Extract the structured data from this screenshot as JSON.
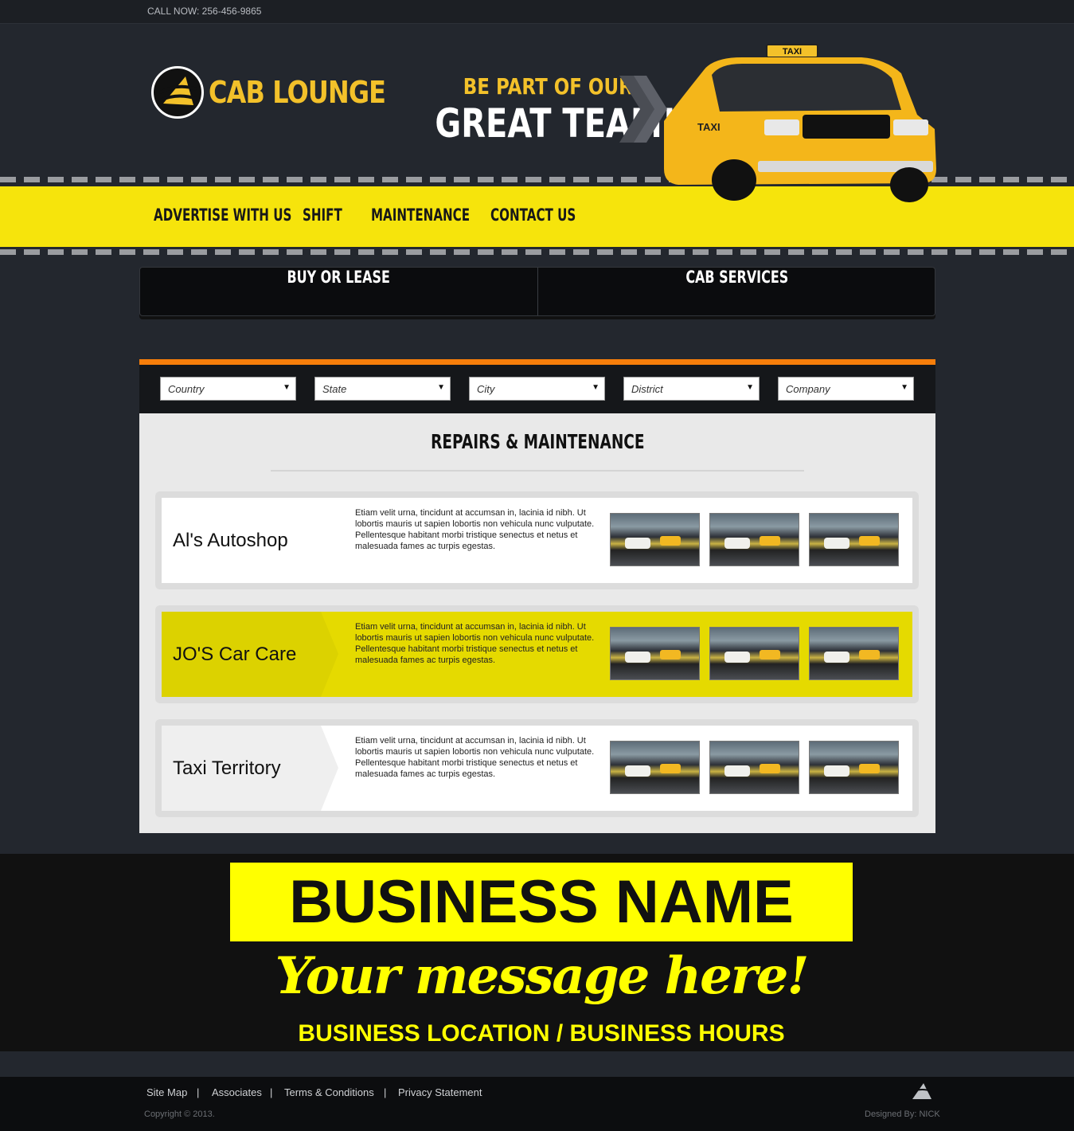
{
  "topbar": {
    "call": "CALL NOW: 256-456-9865"
  },
  "brand": {
    "name": "CAB LOUNGE"
  },
  "hero": {
    "tagline1": "BE PART OF OUR",
    "tagline2": "GREAT TEAM!"
  },
  "nav": [
    "ADVERTISE WITH US",
    "SHIFT",
    "MAINTENANCE",
    "CONTACT US"
  ],
  "tabs": [
    "BUY OR LEASE",
    "CAB SERVICES"
  ],
  "filters": [
    "Country",
    "State",
    "City",
    "District",
    "Company"
  ],
  "section": {
    "title": "REPAIRS & MAINTENANCE"
  },
  "listings": [
    {
      "name": "Al's Autoshop",
      "desc": "Etiam velit urna, tincidunt at accumsan in, lacinia id nibh. Ut lobortis mauris ut sapien lobortis non vehicula nunc vulputate. Pellentesque habitant morbi tristique senectus et netus et malesuada fames ac turpis egestas."
    },
    {
      "name": "JO'S Car Care",
      "desc": "Etiam velit urna, tincidunt at accumsan in, lacinia id nibh. Ut lobortis mauris ut sapien lobortis non vehicula nunc vulputate. Pellentesque habitant morbi tristique senectus et netus et malesuada fames ac turpis egestas."
    },
    {
      "name": "Taxi Territory",
      "desc": "Etiam velit urna, tincidunt at accumsan in, lacinia id nibh. Ut lobortis mauris ut sapien lobortis non vehicula nunc vulputate. Pellentesque habitant morbi tristique senectus et netus et malesuada fames ac turpis egestas."
    }
  ],
  "promo": {
    "business": "BUSINESS NAME",
    "message": "Your message here!",
    "location": "BUSINESS LOCATION / BUSINESS HOURS"
  },
  "footer": {
    "links": [
      "Site Map",
      "Associates",
      "Terms & Conditions",
      "Privacy Statement"
    ],
    "separator": "|",
    "copyright": "Copyright © 2013.",
    "designed": "Designed By: NICK"
  },
  "car": {
    "sign": "TAXI",
    "door": "TAXI"
  },
  "colors": {
    "accent": "#f3c12a",
    "navband": "#f6e40c",
    "orange": "#f77e0a",
    "promoYellow": "#ffff00"
  }
}
